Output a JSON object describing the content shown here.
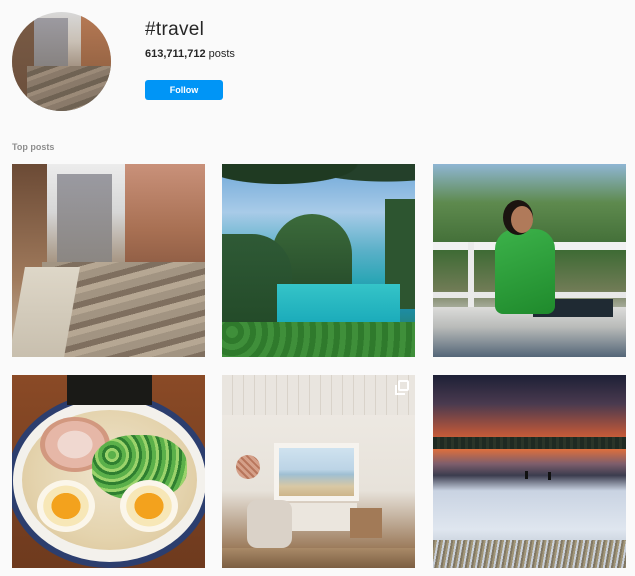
{
  "profile": {
    "hashtag": "#travel",
    "posts_count": "613,711,712",
    "posts_label": " posts",
    "follow_label": "Follow",
    "accent": "#0095f6"
  },
  "sections": {
    "top_posts_label": "Top posts"
  },
  "posts": [
    {
      "subject": "old-town-ruins",
      "multi": false
    },
    {
      "subject": "tropical-lagoon",
      "multi": false
    },
    {
      "subject": "woman-in-green-jacket",
      "multi": false
    },
    {
      "subject": "ramen-bowl",
      "multi": false
    },
    {
      "subject": "beach-cabin-interior",
      "multi": true
    },
    {
      "subject": "snowy-sunset-field",
      "multi": false
    }
  ]
}
